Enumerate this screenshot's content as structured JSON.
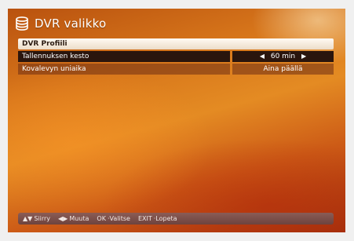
{
  "header": {
    "icon": "database-icon",
    "title": "DVR valikko"
  },
  "menu": {
    "section_title": "DVR Profiili",
    "rows": [
      {
        "label": "Tallennuksen kesto",
        "value": "60 min",
        "selected": true,
        "left_arrow": "◀",
        "right_arrow": "▶"
      },
      {
        "label": "Kovalevyn uniaika",
        "value": "Aina päällä",
        "selected": false
      }
    ]
  },
  "footer": {
    "hints": [
      {
        "key": "▲▼",
        "label": "Siirry"
      },
      {
        "key": "◀▶",
        "label": "Muuta"
      },
      {
        "key": "OK",
        "label": "Valitse"
      },
      {
        "key": "EXIT",
        "label": "Lopeta"
      }
    ]
  },
  "colors": {
    "background_orange": "#e48b23",
    "selected_row": "#2a150d",
    "footer_bar": "#7b4f4a"
  }
}
